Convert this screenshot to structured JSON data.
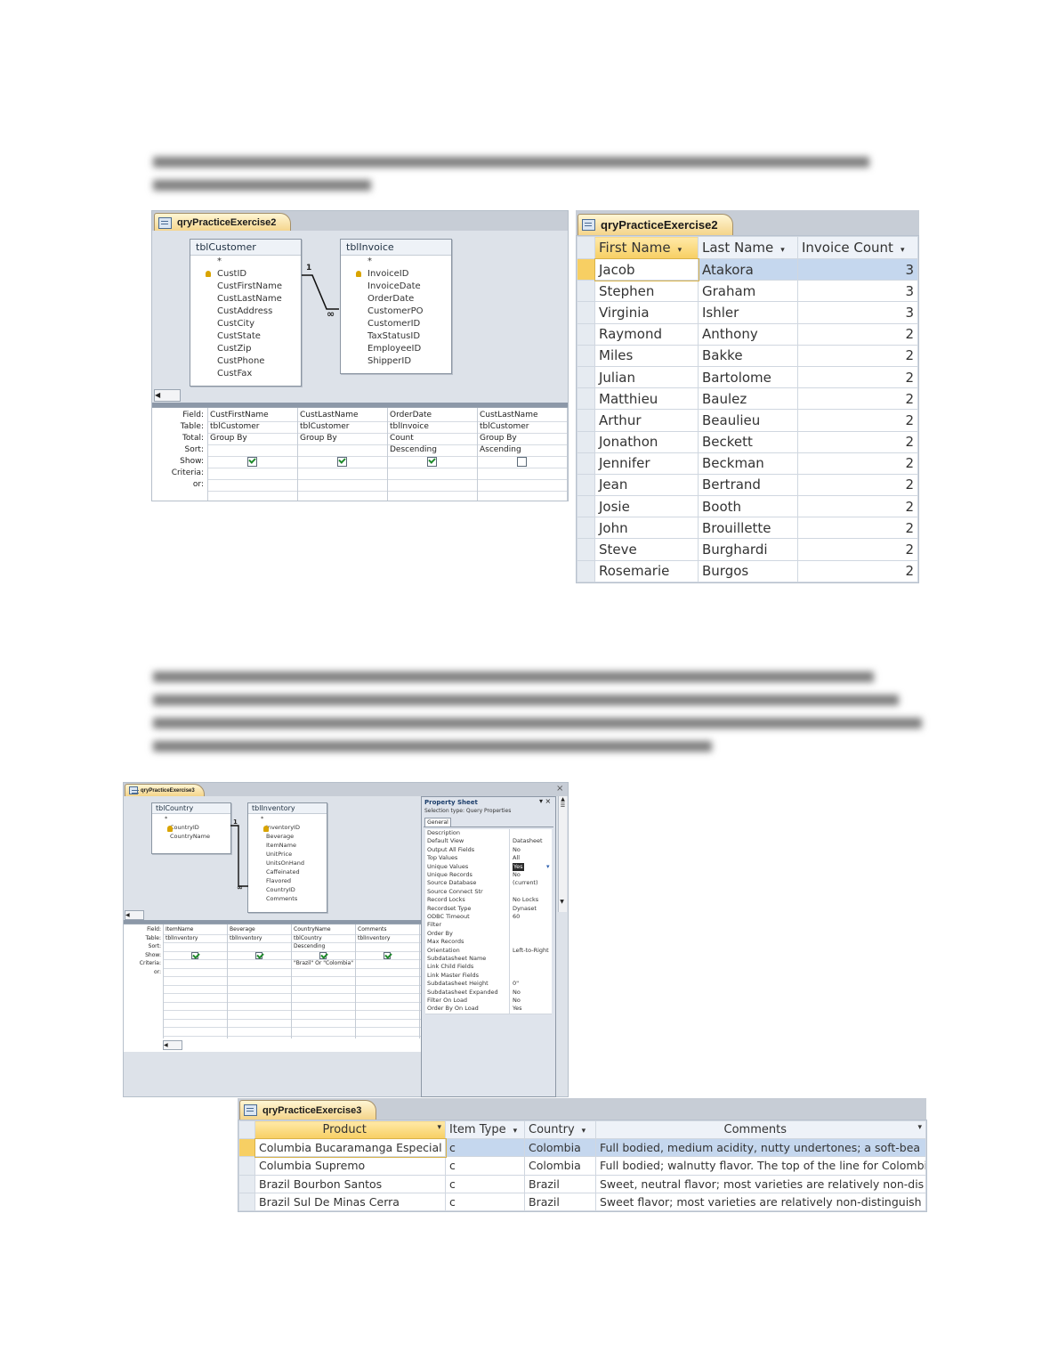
{
  "fig1": {
    "design_tab": "qryPracticeExercise2",
    "table1": {
      "name": "tblCustomer",
      "fields": [
        "*",
        "CustID",
        "CustFirstName",
        "CustLastName",
        "CustAddress",
        "CustCity",
        "CustState",
        "CustZip",
        "CustPhone",
        "CustFax"
      ]
    },
    "table2": {
      "name": "tblInvoice",
      "fields": [
        "*",
        "InvoiceID",
        "InvoiceDate",
        "OrderDate",
        "CustomerPO",
        "CustomerID",
        "TaxStatusID",
        "EmployeeID",
        "ShipperID"
      ]
    },
    "join_one": "1",
    "join_many": "∞",
    "grid_labels": [
      "Field:",
      "Table:",
      "Total:",
      "Sort:",
      "Show:",
      "Criteria:",
      "or:"
    ],
    "columns": [
      {
        "field": "CustFirstName",
        "table": "tblCustomer",
        "total": "Group By",
        "sort": "",
        "show": true
      },
      {
        "field": "CustLastName",
        "table": "tblCustomer",
        "total": "Group By",
        "sort": "",
        "show": true
      },
      {
        "field": "OrderDate",
        "table": "tblInvoice",
        "total": "Count",
        "sort": "Descending",
        "show": true
      },
      {
        "field": "CustLastName",
        "table": "tblCustomer",
        "total": "Group By",
        "sort": "Ascending",
        "show": false
      }
    ]
  },
  "ds1": {
    "tab": "qryPracticeExercise2",
    "headers": [
      "First Name",
      "Last Name",
      "Invoice Count"
    ],
    "rows": [
      [
        "Jacob",
        "Atakora",
        "3"
      ],
      [
        "Stephen",
        "Graham",
        "3"
      ],
      [
        "Virginia",
        "Ishler",
        "3"
      ],
      [
        "Raymond",
        "Anthony",
        "2"
      ],
      [
        "Miles",
        "Bakke",
        "2"
      ],
      [
        "Julian",
        "Bartolome",
        "2"
      ],
      [
        "Matthieu",
        "Baulez",
        "2"
      ],
      [
        "Arthur",
        "Beaulieu",
        "2"
      ],
      [
        "Jonathon",
        "Beckett",
        "2"
      ],
      [
        "Jennifer",
        "Beckman",
        "2"
      ],
      [
        "Jean",
        "Bertrand",
        "2"
      ],
      [
        "Josie",
        "Booth",
        "2"
      ],
      [
        "John",
        "Brouillette",
        "2"
      ],
      [
        "Steve",
        "Burghardi",
        "2"
      ],
      [
        "Rosemarie",
        "Burgos",
        "2"
      ]
    ]
  },
  "fig2": {
    "design_tab": "qryPracticeExercise3",
    "close": "×",
    "table1": {
      "name": "tblCountry",
      "fields": [
        "*",
        "CountryID",
        "CountryName"
      ]
    },
    "table2": {
      "name": "tblInventory",
      "fields": [
        "*",
        "InventoryID",
        "Beverage",
        "ItemName",
        "UnitPrice",
        "UnitsOnHand",
        "Caffeinated",
        "Flavored",
        "CountryID",
        "Comments"
      ]
    },
    "join_one": "1",
    "join_many": "∞",
    "grid_labels": [
      "Field:",
      "Table:",
      "Sort:",
      "Show:",
      "Criteria:",
      "or:"
    ],
    "columns": [
      {
        "field": "ItemName",
        "table": "tblInventory",
        "sort": "",
        "show": true,
        "criteria": ""
      },
      {
        "field": "Beverage",
        "table": "tblInventory",
        "sort": "",
        "show": true,
        "criteria": ""
      },
      {
        "field": "CountryName",
        "table": "tblCountry",
        "sort": "Descending",
        "show": true,
        "criteria": "\"Brazil\" Or \"Colombia\""
      },
      {
        "field": "Comments",
        "table": "tblInventory",
        "sort": "",
        "show": true,
        "criteria": ""
      }
    ],
    "property_sheet": {
      "title": "Property Sheet",
      "selection": "Selection type:  Query Properties",
      "tab": "General",
      "rows": [
        [
          "Description",
          ""
        ],
        [
          "Default View",
          "Datasheet"
        ],
        [
          "Output All Fields",
          "No"
        ],
        [
          "Top Values",
          "All"
        ],
        [
          "Unique Values",
          "Yes"
        ],
        [
          "Unique Records",
          "No"
        ],
        [
          "Source Database",
          "(current)"
        ],
        [
          "Source Connect Str",
          ""
        ],
        [
          "Record Locks",
          "No Locks"
        ],
        [
          "Recordset Type",
          "Dynaset"
        ],
        [
          "ODBC Timeout",
          "60"
        ],
        [
          "Filter",
          ""
        ],
        [
          "Order By",
          ""
        ],
        [
          "Max Records",
          ""
        ],
        [
          "Orientation",
          "Left-to-Right"
        ],
        [
          "Subdatasheet Name",
          ""
        ],
        [
          "Link Child Fields",
          ""
        ],
        [
          "Link Master Fields",
          ""
        ],
        [
          "Subdatasheet Height",
          "0\""
        ],
        [
          "Subdatasheet Expanded",
          "No"
        ],
        [
          "Filter On Load",
          "No"
        ],
        [
          "Order By On Load",
          "Yes"
        ]
      ]
    }
  },
  "ds2": {
    "tab": "qryPracticeExercise3",
    "headers": [
      "Product",
      "Item Type",
      "Country",
      "Comments"
    ],
    "rows": [
      [
        "Columbia Bucaramanga Especial",
        "c",
        "Colombia",
        "Full bodied, medium acidity, nutty undertones; a soft-bea"
      ],
      [
        "Columbia Supremo",
        "c",
        "Colombia",
        "Full bodied; walnutty flavor. The top of the line for Colombia"
      ],
      [
        "Brazil Bourbon Santos",
        "c",
        "Brazil",
        "Sweet, neutral flavor; most varieties are relatively non-dis"
      ],
      [
        "Brazil Sul De Minas Cerra",
        "c",
        "Brazil",
        "Sweet flavor; most varieties are relatively non-distinguish"
      ]
    ]
  }
}
